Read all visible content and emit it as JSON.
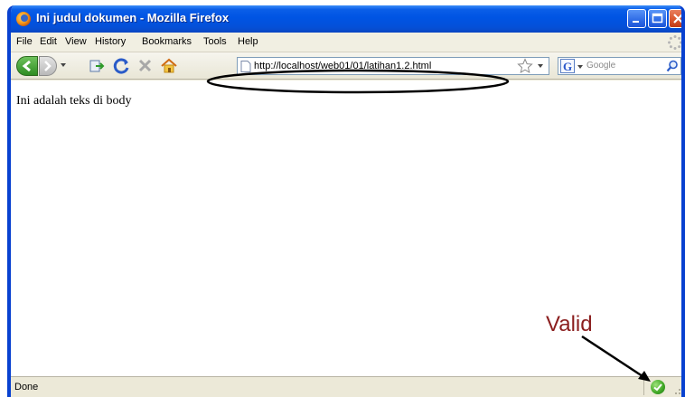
{
  "window": {
    "title": "Ini judul dokumen - Mozilla Firefox"
  },
  "menu": {
    "items": [
      {
        "key": "F",
        "rest": "ile"
      },
      {
        "key": "E",
        "rest": "dit"
      },
      {
        "key": "V",
        "rest": "iew"
      },
      {
        "key": "",
        "rest": "History",
        "key_index": 2
      },
      {
        "key": "B",
        "rest": "ookmarks"
      },
      {
        "key": "T",
        "rest": "ools"
      },
      {
        "key": "H",
        "rest": "elp"
      }
    ],
    "labels": [
      "File",
      "Edit",
      "View",
      "History",
      "Bookmarks",
      "Tools",
      "Help"
    ]
  },
  "toolbar": {
    "icons": [
      "back-icon",
      "forward-icon",
      "history-dropdown-icon",
      "reload-icon",
      "stop-icon",
      "home-icon"
    ]
  },
  "address_bar": {
    "url": "http://localhost/web01/01/latihan1.2.html"
  },
  "search_bar": {
    "engine_letter": "G",
    "placeholder": "Google"
  },
  "page": {
    "body_text": "Ini adalah teks di body"
  },
  "status_bar": {
    "text": "Done"
  },
  "annotation": {
    "label": "Valid",
    "color": "#8b1e1e"
  },
  "colors": {
    "titlebar": "#0054e3",
    "chrome": "#ece9d8",
    "valid_green": "#3ea624"
  }
}
